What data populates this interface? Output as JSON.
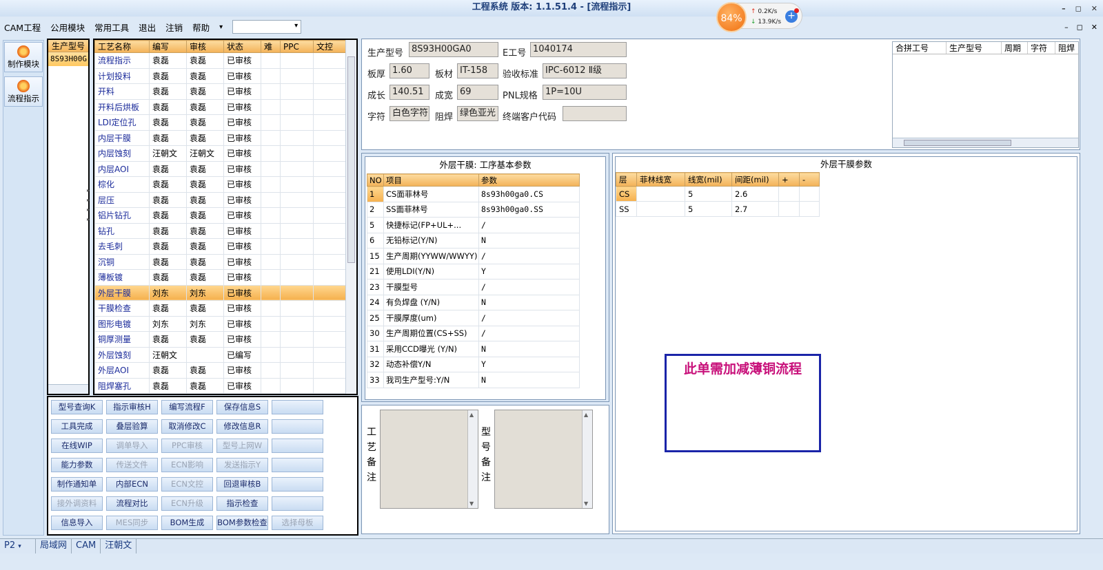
{
  "window": {
    "title": "工程系统   版本: 1.1.51.4 - [流程指示]",
    "controls": [
      "–",
      "◻",
      "✕"
    ]
  },
  "net": {
    "percent": "84%",
    "up": "0.2K/s",
    "down": "13.9K/s",
    "plus": "+"
  },
  "menu": {
    "items": [
      "CAM工程",
      "公用模块",
      "常用工具",
      "退出",
      "注销",
      "帮助"
    ],
    "more": "▾",
    "mdi_controls": [
      "–",
      "◻",
      "✕"
    ]
  },
  "left_toolbar": [
    {
      "label": "制作模块"
    },
    {
      "label": "流程指示"
    }
  ],
  "part": {
    "header": "生产型号",
    "value": "8S93H00G"
  },
  "process": {
    "headers": [
      "工艺名称",
      "编写",
      "审核",
      "状态",
      "难",
      "PPC",
      "文控"
    ],
    "rows": [
      [
        "流程指示",
        "袁磊",
        "袁磊",
        "已审核"
      ],
      [
        "计划投料",
        "袁磊",
        "袁磊",
        "已审核"
      ],
      [
        "开料",
        "袁磊",
        "袁磊",
        "已审核"
      ],
      [
        "开料后烘板",
        "袁磊",
        "袁磊",
        "已审核"
      ],
      [
        "LDI定位孔",
        "袁磊",
        "袁磊",
        "已审核"
      ],
      [
        "内层干膜",
        "袁磊",
        "袁磊",
        "已审核"
      ],
      [
        "内层蚀刻",
        "汪朝文",
        "汪朝文",
        "已审核"
      ],
      [
        "内层AOI",
        "袁磊",
        "袁磊",
        "已审核"
      ],
      [
        "棕化",
        "袁磊",
        "袁磊",
        "已审核"
      ],
      [
        "层压",
        "袁磊",
        "袁磊",
        "已审核"
      ],
      [
        "铝片钻孔",
        "袁磊",
        "袁磊",
        "已审核"
      ],
      [
        "钻孔",
        "袁磊",
        "袁磊",
        "已审核"
      ],
      [
        "去毛刺",
        "袁磊",
        "袁磊",
        "已审核"
      ],
      [
        "沉铜",
        "袁磊",
        "袁磊",
        "已审核"
      ],
      [
        "薄板镀",
        "袁磊",
        "袁磊",
        "已审核"
      ],
      [
        "外层干膜",
        "刘东",
        "刘东",
        "已审核"
      ],
      [
        "干膜检查",
        "袁磊",
        "袁磊",
        "已审核"
      ],
      [
        "图形电镀",
        "刘东",
        "刘东",
        "已审核"
      ],
      [
        "铜厚测量",
        "袁磊",
        "袁磊",
        "已审核"
      ],
      [
        "外层蚀刻",
        "汪朝文",
        "",
        "已编写"
      ],
      [
        "外层AOI",
        "袁磊",
        "袁磊",
        "已审核"
      ],
      [
        "阻焊塞孔",
        "袁磊",
        "袁磊",
        "已审核"
      ]
    ],
    "selected_index": 15
  },
  "buttons": [
    {
      "label": "型号查询K",
      "enabled": true
    },
    {
      "label": "指示审核H",
      "enabled": true
    },
    {
      "label": "编写流程F",
      "enabled": true
    },
    {
      "label": "保存信息S",
      "enabled": true
    },
    {
      "label": "",
      "enabled": true
    },
    {
      "label": "工具完成",
      "enabled": true
    },
    {
      "label": "叠层验算",
      "enabled": true
    },
    {
      "label": "取消修改C",
      "enabled": true
    },
    {
      "label": "修改信息R",
      "enabled": true
    },
    {
      "label": "",
      "enabled": true
    },
    {
      "label": "在线WIP",
      "enabled": true
    },
    {
      "label": "调单导入",
      "enabled": false
    },
    {
      "label": "PPC审核",
      "enabled": false
    },
    {
      "label": "型号上网W",
      "enabled": false
    },
    {
      "label": "",
      "enabled": true
    },
    {
      "label": "能力参数",
      "enabled": true
    },
    {
      "label": "传送文件",
      "enabled": false
    },
    {
      "label": "ECN影响",
      "enabled": false
    },
    {
      "label": "发送指示Y",
      "enabled": false
    },
    {
      "label": "",
      "enabled": true
    },
    {
      "label": "制作通知单",
      "enabled": true
    },
    {
      "label": "内部ECN",
      "enabled": true
    },
    {
      "label": "ECN文控",
      "enabled": false
    },
    {
      "label": "回退审核B",
      "enabled": true
    },
    {
      "label": "",
      "enabled": true
    },
    {
      "label": "接外调资料",
      "enabled": false
    },
    {
      "label": "流程对比",
      "enabled": true
    },
    {
      "label": "ECN升级",
      "enabled": false
    },
    {
      "label": "指示检查",
      "enabled": true
    },
    {
      "label": "",
      "enabled": true
    },
    {
      "label": "信息导入",
      "enabled": true
    },
    {
      "label": "MES同步",
      "enabled": false
    },
    {
      "label": "BOM生成",
      "enabled": true
    },
    {
      "label": "BOM参数检查",
      "enabled": true
    },
    {
      "label": "选择母板",
      "enabled": false
    }
  ],
  "info": {
    "part_label": "生产型号",
    "part_value": "8S93H00GA0",
    "e_label": "E工号",
    "e_value": "1040174",
    "thickness_label": "板厚",
    "thickness_value": "1.60",
    "material_label": "板材",
    "material_value": "IT-158",
    "standard_label": "验收标准",
    "standard_value": "IPC-6012 Ⅱ级",
    "length_label": "成长",
    "length_value": "140.51",
    "width_label": "成宽",
    "width_value": "69",
    "pnl_label": "PNL规格",
    "pnl_value": "1P=10U",
    "char_label": "字符",
    "char_value": "白色字符",
    "mask_label": "阻焊",
    "mask_value": "绿色亚光",
    "customer_label": "终端客户代码",
    "customer_value": ""
  },
  "merge_table": {
    "headers": [
      "合拼工号",
      "生产型号",
      "周期",
      "字符",
      "阻焊"
    ]
  },
  "params": {
    "title": "外层干膜: 工序基本参数",
    "headers": [
      "NO",
      "项目",
      "参数"
    ],
    "rows": [
      [
        "1",
        "CS面菲林号",
        "8s93h00ga0.CS"
      ],
      [
        "2",
        "SS面菲林号",
        "8s93h00ga0.SS"
      ],
      [
        "5",
        "快捷标记(FP+UL+...",
        "/"
      ],
      [
        "6",
        "无铅标记(Y/N)",
        "N"
      ],
      [
        "15",
        "生产周期(YYWW/WWYY)",
        "/"
      ],
      [
        "21",
        "使用LDI(Y/N)",
        "Y"
      ],
      [
        "23",
        "干膜型号",
        "/"
      ],
      [
        "24",
        "有负焊盘 (Y/N)",
        "N"
      ],
      [
        "25",
        "干膜厚度(um)",
        "/"
      ],
      [
        "30",
        "生产周期位置(CS+SS)",
        "/"
      ],
      [
        "31",
        "采用CCD曝光 (Y/N)",
        "N"
      ],
      [
        "32",
        "动态补偿Y/N",
        "Y"
      ],
      [
        "33",
        "我司生产型号:Y/N",
        "N"
      ]
    ]
  },
  "film": {
    "title": "外层干膜参数",
    "headers": [
      "层",
      "菲林线宽",
      "线宽(mil)",
      "间距(mil)",
      "+",
      "-"
    ],
    "rows": [
      [
        "CS",
        "",
        "5",
        "2.6",
        "",
        ""
      ],
      [
        "SS",
        "",
        "5",
        "2.7",
        "",
        ""
      ]
    ]
  },
  "notice": "此单需加减薄铜流程",
  "remarks": {
    "process_label": "工艺备注",
    "part_label": "型号备注"
  },
  "status": {
    "page": "P2",
    "items": [
      "局域网",
      "CAM",
      "汪朝文"
    ]
  }
}
